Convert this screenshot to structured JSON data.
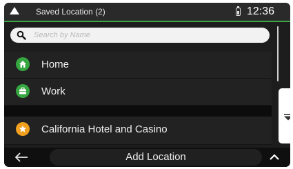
{
  "status_bar": {
    "title": "Saved Location (2)",
    "time": "12:36"
  },
  "search": {
    "placeholder": "Search by Name",
    "value": ""
  },
  "locations": [
    {
      "label": "Home",
      "icon": "home-icon",
      "color": "#36a641"
    },
    {
      "label": "Work",
      "icon": "briefcase-icon",
      "color": "#36a641"
    }
  ],
  "suggested": [
    {
      "label": "California Hotel and Casino",
      "icon": "star-icon",
      "color": "#f0a01e"
    }
  ],
  "bottom_bar": {
    "add_location_label": "Add Location",
    "back_icon": "back-arrow-icon",
    "more_icon": "chevron-up-icon"
  },
  "colors": {
    "accent": "#3da64a",
    "background": "#1d1d1d"
  }
}
